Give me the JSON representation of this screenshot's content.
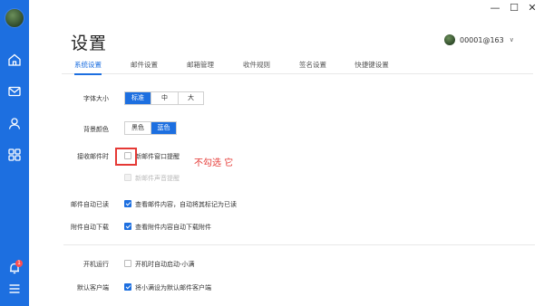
{
  "window": {
    "minimize": "—",
    "maximize": "☐",
    "close": "✕"
  },
  "page_title": "设置",
  "account": {
    "name": "00001@163",
    "chevron": "∨"
  },
  "tabs": [
    {
      "label": "系统设置",
      "active": true
    },
    {
      "label": "邮件设置",
      "active": false
    },
    {
      "label": "邮箱管理",
      "active": false
    },
    {
      "label": "收件规则",
      "active": false
    },
    {
      "label": "签名设置",
      "active": false
    },
    {
      "label": "快捷键设置",
      "active": false
    }
  ],
  "font_size": {
    "label": "字体大小",
    "options": [
      "标准",
      "中",
      "大"
    ],
    "selected": "标准"
  },
  "bg_color": {
    "label": "背景颜色",
    "options": [
      "黑色",
      "蓝色"
    ],
    "selected": "蓝色"
  },
  "receive": {
    "label": "接收邮件时",
    "popup": {
      "text": "新邮件窗口提醒",
      "checked": false
    },
    "sound": {
      "text": "新邮件声音提醒",
      "checked": false,
      "disabled": true
    }
  },
  "auto_read": {
    "label": "邮件自动已读",
    "text": "查看邮件内容，自动将其标记为已读",
    "checked": true
  },
  "auto_download": {
    "label": "附件自动下载",
    "text": "查看附件内容自动下载附件",
    "checked": true
  },
  "startup": {
    "label": "开机运行",
    "text": "开机时自动启动-小满",
    "checked": false
  },
  "default_client": {
    "label": "默认客户端",
    "text": "将小满设为默认邮件客户端",
    "checked": true
  },
  "annotation": "不勾选 它",
  "notification_badge": "1",
  "colors": {
    "primary": "#1d6fe0",
    "annotation": "#e53935"
  },
  "sidebar_icons": [
    "home-icon",
    "mail-icon",
    "contacts-icon",
    "apps-icon",
    "bell-icon",
    "menu-icon"
  ]
}
